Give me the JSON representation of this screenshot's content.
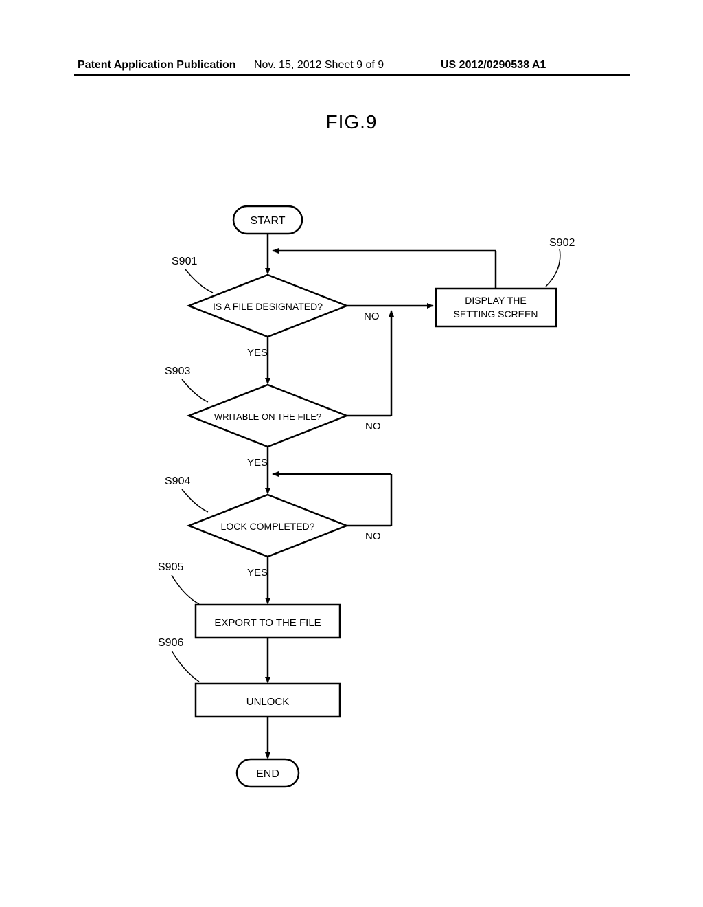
{
  "header": {
    "left": "Patent Application Publication",
    "mid": "Nov. 15, 2012  Sheet 9 of 9",
    "right": "US 2012/0290538 A1"
  },
  "figure_title": "FIG.9",
  "nodes": {
    "start": "START",
    "s901_label": "S901",
    "s901_text": "IS A FILE DESIGNATED?",
    "s902_label": "S902",
    "s902_text1": "DISPLAY THE",
    "s902_text2": "SETTING SCREEN",
    "s903_label": "S903",
    "s903_text": "WRITABLE ON THE FILE?",
    "s904_label": "S904",
    "s904_text": "LOCK COMPLETED?",
    "s905_label": "S905",
    "s905_text": "EXPORT TO THE FILE",
    "s906_label": "S906",
    "s906_text": "UNLOCK",
    "end": "END"
  },
  "edges": {
    "yes": "YES",
    "no": "NO"
  }
}
